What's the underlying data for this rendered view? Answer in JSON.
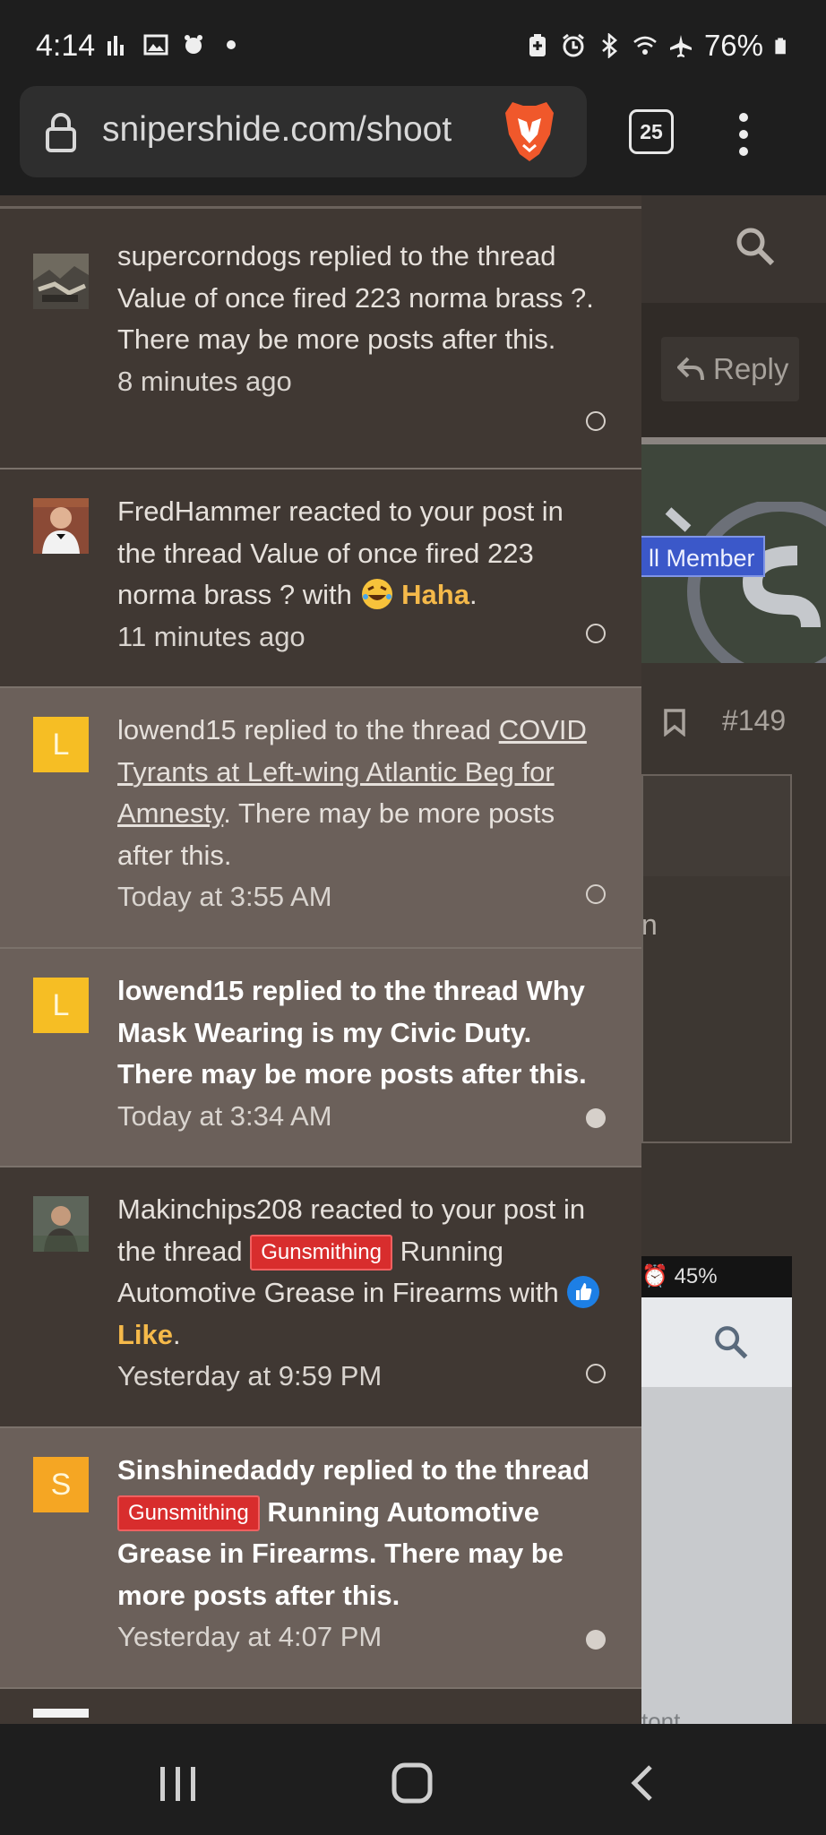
{
  "status_bar": {
    "time": "4:14",
    "battery": "76%",
    "icons": [
      "signal-bars-icon",
      "gallery-icon",
      "app-icon",
      "dot-icon",
      "battery-saver-icon",
      "alarm-icon",
      "bluetooth-icon",
      "wifi-icon",
      "airplane-icon",
      "battery-icon"
    ]
  },
  "browser": {
    "url": "snipershide.com/shoot",
    "tab_count": "25",
    "icons": [
      "lock-icon",
      "brave-lion-icon",
      "tabs-icon",
      "more-vert-icon"
    ]
  },
  "background_page": {
    "reply_label": "Reply",
    "member_badge": "ll Member",
    "post_number": "#149",
    "fragment_text": "n",
    "inner_screenshot_battery": "45%",
    "bottom_fragment": "tont"
  },
  "notifications": [
    {
      "avatar_type": "image",
      "avatar_name": "supercorndogs-avatar",
      "text": "supercorndogs replied to the thread Value of once fired 223 norma brass ?. There may be more posts after this.",
      "time": "8 minutes ago",
      "unread": false
    },
    {
      "avatar_type": "image",
      "avatar_name": "fredhammer-avatar",
      "text_before": "FredHammer reacted to your post in the thread Value of once fired 223 norma brass ? with ",
      "reaction": "Haha",
      "text_after": ".",
      "time": "11 minutes ago",
      "unread": false
    },
    {
      "avatar_type": "letter",
      "avatar_letter": "L",
      "text_before": "lowend15 replied to the thread ",
      "link_text": "COVID Tyrants at Left-wing Atlantic Beg for Amnesty",
      "text_after": ". There may be more posts after this.",
      "time": "Today at 3:55 AM",
      "unread": false
    },
    {
      "avatar_type": "letter",
      "avatar_letter": "L",
      "text": "lowend15 replied to the thread Why Mask Wearing is my Civic Duty. There may be more posts after this.",
      "time": "Today at 3:34 AM",
      "unread": true
    },
    {
      "avatar_type": "image",
      "avatar_name": "makinchips208-avatar",
      "text_before": "Makinchips208 reacted to your post in the thread ",
      "prefix": "Gunsmithing",
      "text_middle": " Running Automotive Grease in Firearms with ",
      "reaction": "Like",
      "text_after": ".",
      "time": "Yesterday at 9:59 PM",
      "unread": false
    },
    {
      "avatar_type": "letter",
      "avatar_letter": "S",
      "text_before": "Sinshinedaddy replied to the thread ",
      "prefix": "Gunsmithing",
      "text_after": " Running Automotive Grease in Firearms. There may be more posts after this.",
      "time": "Yesterday at 4:07 PM",
      "unread": true
    }
  ],
  "colors": {
    "panel_read": "#403833",
    "panel_unread": "#6b605a",
    "reaction_gold": "#f5b94a",
    "prefix_red": "#d82d2d",
    "badge_blue": "#3b58c9"
  },
  "nav_bar": {
    "icons": [
      "recents-icon",
      "home-icon",
      "back-icon"
    ]
  }
}
